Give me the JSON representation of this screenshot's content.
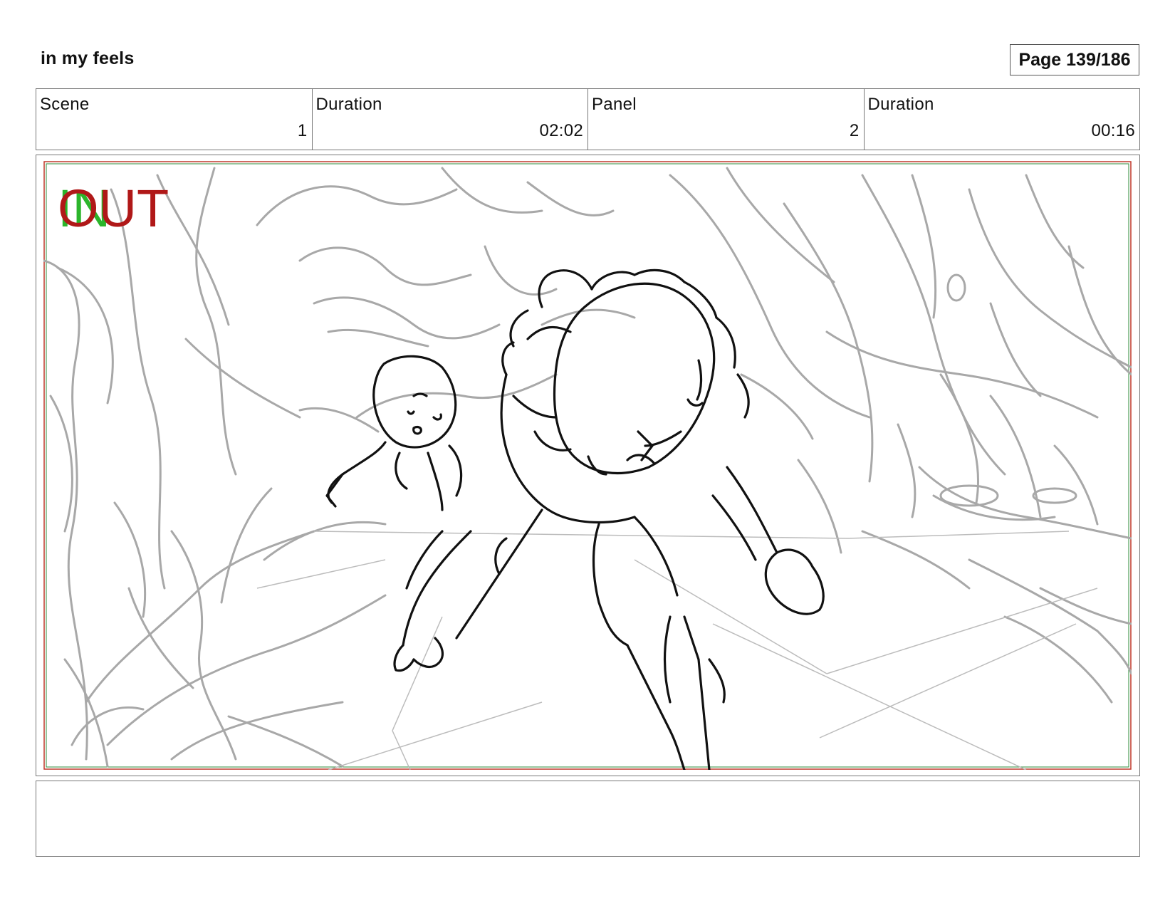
{
  "header": {
    "project_title": "in my feels",
    "page_label": "Page 139/186"
  },
  "info": {
    "scene_label": "Scene",
    "scene_value": "1",
    "scene_duration_label": "Duration",
    "scene_duration_value": "02:02",
    "panel_label": "Panel",
    "panel_value": "2",
    "panel_duration_label": "Duration",
    "panel_duration_value": "00:16"
  },
  "panel": {
    "in_mark": "IN",
    "out_mark": "OUT",
    "safe_frame_colors": {
      "outer": "#c0392b",
      "inner": "#2e8b3a"
    },
    "sketch_colors": {
      "background_lines": "#a8a8a8",
      "character_lines": "#111111"
    }
  },
  "notes": {
    "text": ""
  }
}
